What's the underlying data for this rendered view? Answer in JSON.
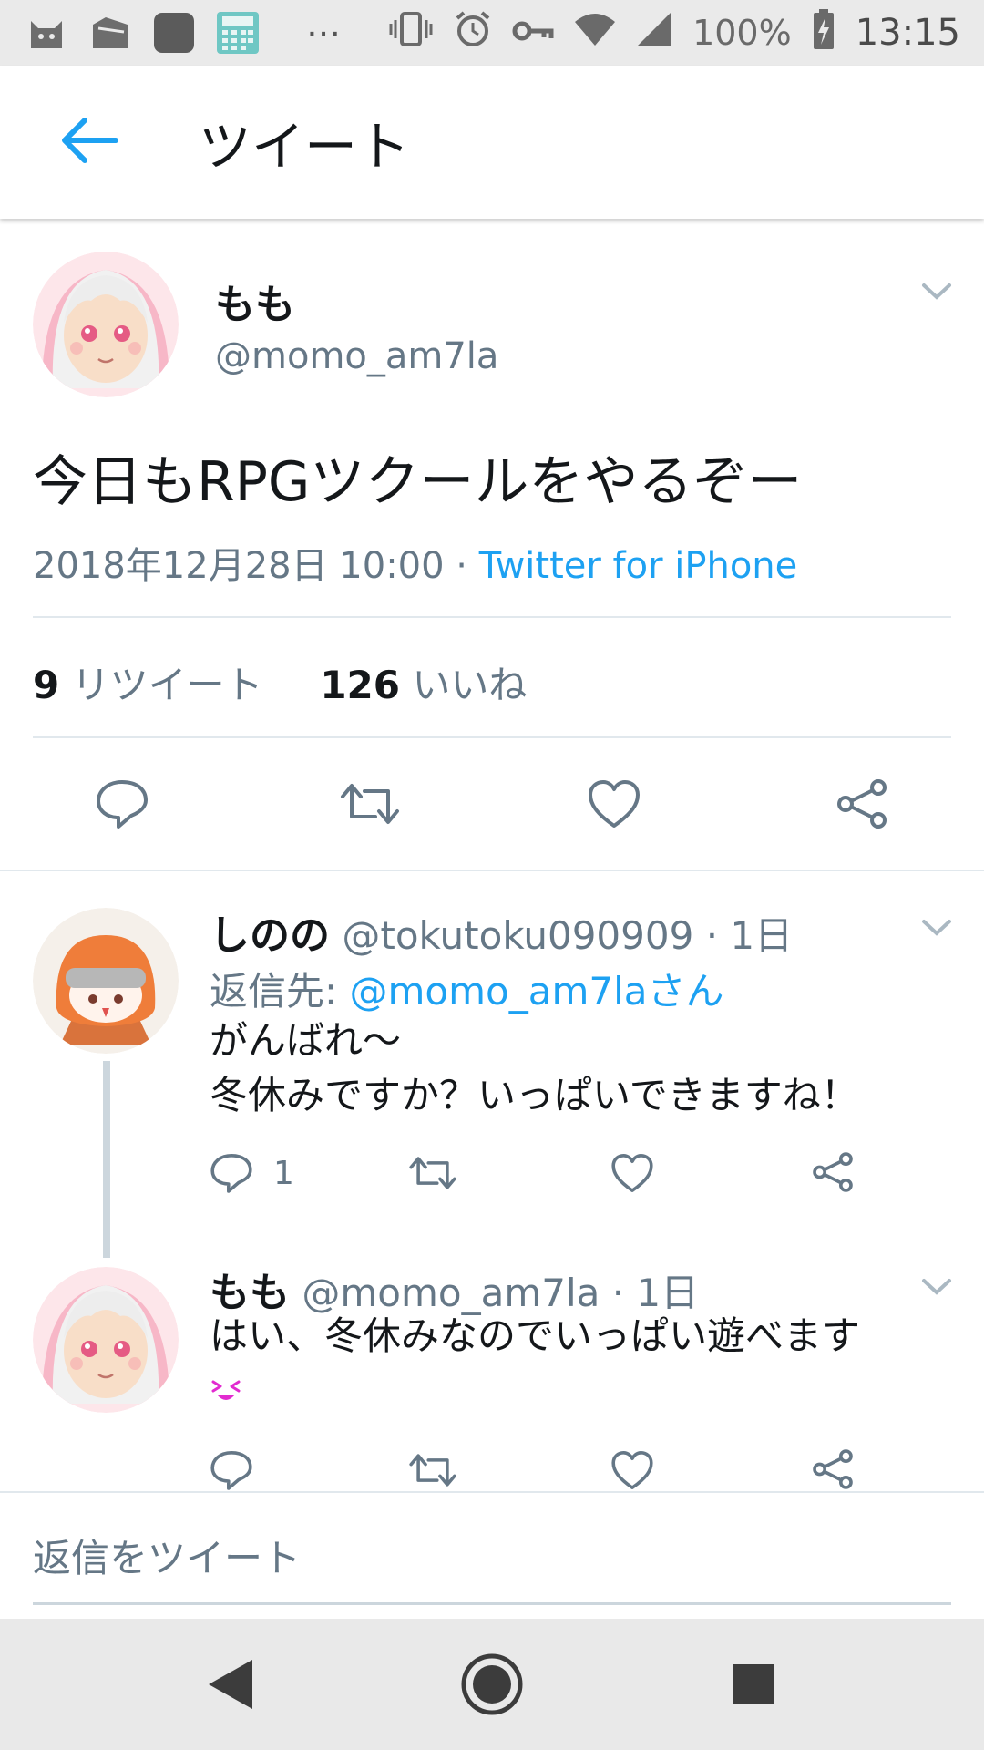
{
  "status_bar": {
    "battery": "100%",
    "time": "13:15",
    "overflow": "⋯"
  },
  "app_bar": {
    "title": "ツイート"
  },
  "main_tweet": {
    "name": "もも",
    "handle": "@momo_am7la",
    "text": "今日もRPGツクールをやるぞー",
    "timestamp": "2018年12月28日 10:00",
    "separator": " · ",
    "source": "Twitter for iPhone",
    "retweet_count": "9",
    "retweet_label": "リツイート",
    "like_count": "126",
    "like_label": "いいね"
  },
  "replies": [
    {
      "name": "しのの",
      "handle": "@tokutoku090909",
      "time": "· 1日",
      "reply_to_prefix": "返信先: ",
      "reply_to_mention": "@momo_am7laさん",
      "line1": "がんばれ〜",
      "line2": "冬休みですか？いっぱいできますね！",
      "reply_count": "1"
    },
    {
      "name": "もも",
      "handle": "@momo_am7la",
      "time": "· 1日",
      "line1": "はい、冬休みなのでいっぱい遊べます"
    }
  ],
  "composer": {
    "placeholder": "返信をツイート"
  },
  "colors": {
    "accent": "#1da1f2",
    "secondary_text": "#657786",
    "divider": "#e1e8ed"
  },
  "icons": [
    "cat-app-icon",
    "file-icon",
    "app-icon",
    "calculator-app-icon",
    "vibrate-icon",
    "alarm-icon",
    "vpn-key-icon",
    "wifi-icon",
    "signal-icon",
    "battery-charging-icon",
    "back-arrow-icon",
    "chevron-down-icon",
    "reply-icon",
    "retweet-icon",
    "like-icon",
    "share-icon",
    "squint-emoji-icon",
    "nav-back-icon",
    "nav-home-icon",
    "nav-recents-icon"
  ]
}
